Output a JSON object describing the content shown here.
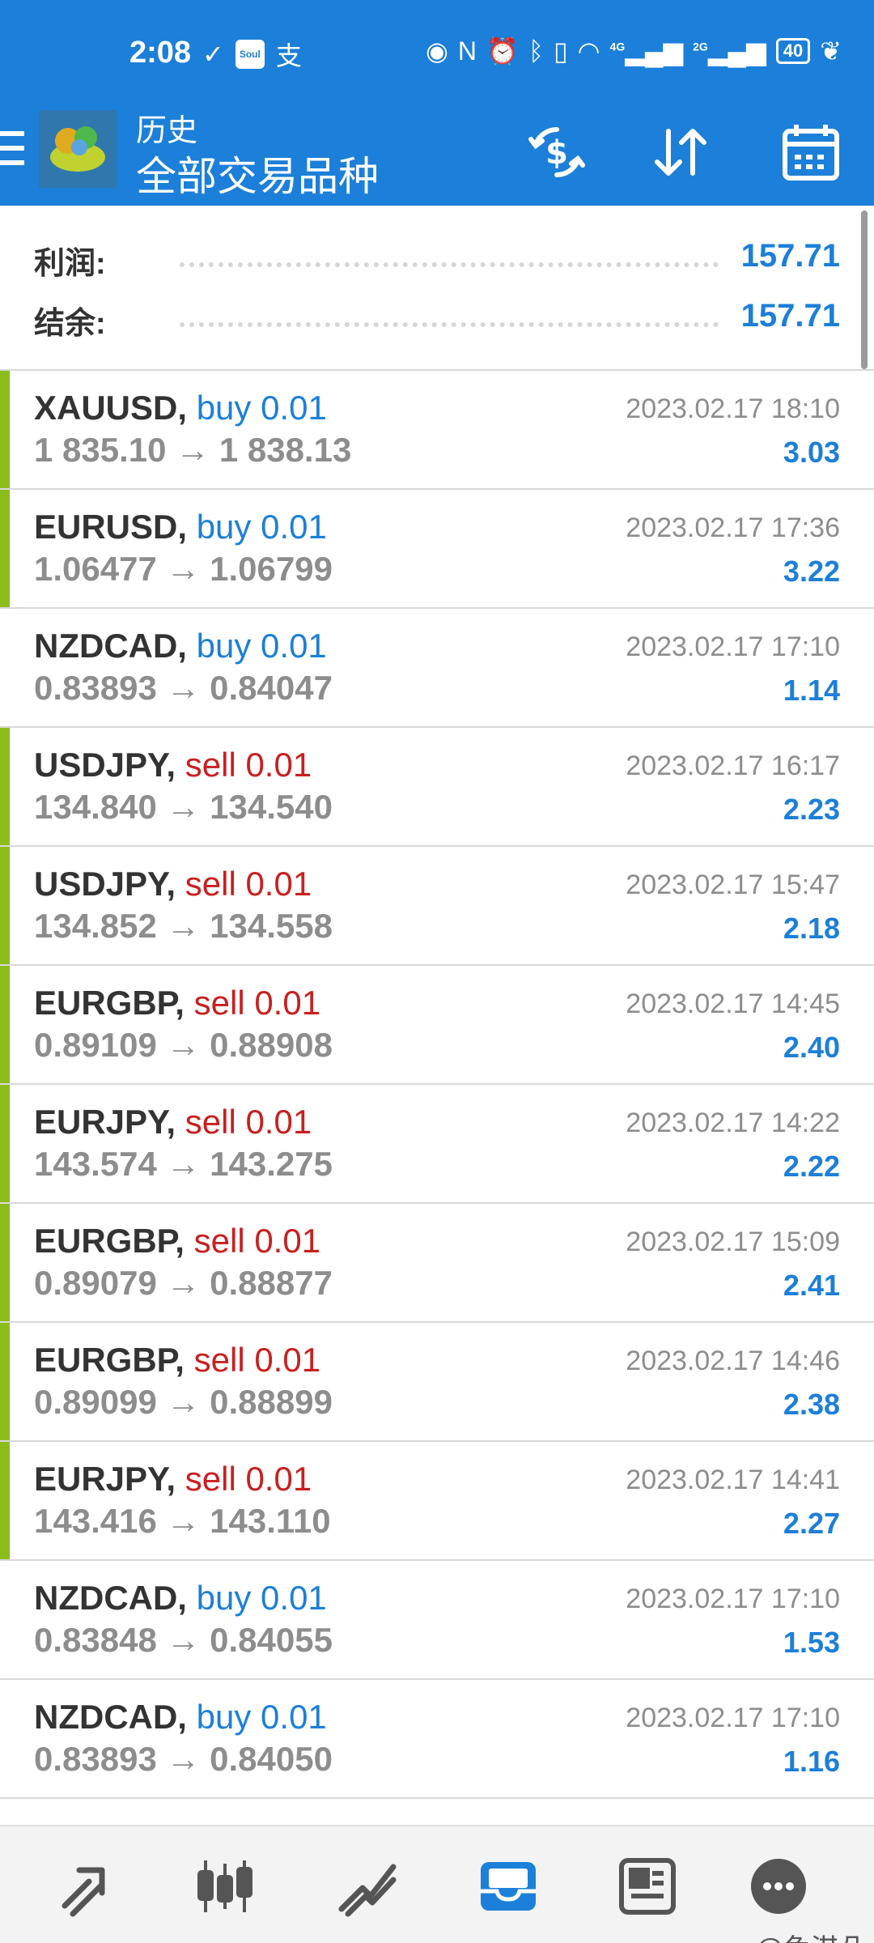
{
  "status_bar": {
    "time": "2:08",
    "soul_label": "Soul",
    "signal_4g": "4G",
    "signal_2g": "2G",
    "battery": "40"
  },
  "header": {
    "title": "历史",
    "subtitle": "全部交易品种"
  },
  "summary": {
    "profit_label": "利润:",
    "profit_value": "157.71",
    "balance_label": "结余:",
    "balance_value": "157.71"
  },
  "trades": [
    {
      "symbol": "XAUUSD,",
      "side": "buy 0.01",
      "type": "buy",
      "prices": "1 835.10 → 1 838.13",
      "date": "2023.02.17 18:10",
      "profit": "3.03",
      "marker": true
    },
    {
      "symbol": "EURUSD,",
      "side": "buy 0.01",
      "type": "buy",
      "prices": "1.06477 → 1.06799",
      "date": "2023.02.17 17:36",
      "profit": "3.22",
      "marker": true
    },
    {
      "symbol": "NZDCAD,",
      "side": "buy 0.01",
      "type": "buy",
      "prices": "0.83893 → 0.84047",
      "date": "2023.02.17 17:10",
      "profit": "1.14",
      "marker": false
    },
    {
      "symbol": "USDJPY,",
      "side": "sell 0.01",
      "type": "sell",
      "prices": "134.840 → 134.540",
      "date": "2023.02.17 16:17",
      "profit": "2.23",
      "marker": true
    },
    {
      "symbol": "USDJPY,",
      "side": "sell 0.01",
      "type": "sell",
      "prices": "134.852 → 134.558",
      "date": "2023.02.17 15:47",
      "profit": "2.18",
      "marker": true
    },
    {
      "symbol": "EURGBP,",
      "side": "sell 0.01",
      "type": "sell",
      "prices": "0.89109 → 0.88908",
      "date": "2023.02.17 14:45",
      "profit": "2.40",
      "marker": true
    },
    {
      "symbol": "EURJPY,",
      "side": "sell 0.01",
      "type": "sell",
      "prices": "143.574 → 143.275",
      "date": "2023.02.17 14:22",
      "profit": "2.22",
      "marker": true
    },
    {
      "symbol": "EURGBP,",
      "side": "sell 0.01",
      "type": "sell",
      "prices": "0.89079 → 0.88877",
      "date": "2023.02.17 15:09",
      "profit": "2.41",
      "marker": true
    },
    {
      "symbol": "EURGBP,",
      "side": "sell 0.01",
      "type": "sell",
      "prices": "0.89099 → 0.88899",
      "date": "2023.02.17 14:46",
      "profit": "2.38",
      "marker": true
    },
    {
      "symbol": "EURJPY,",
      "side": "sell 0.01",
      "type": "sell",
      "prices": "143.416 → 143.110",
      "date": "2023.02.17 14:41",
      "profit": "2.27",
      "marker": true
    },
    {
      "symbol": "NZDCAD,",
      "side": "buy 0.01",
      "type": "buy",
      "prices": "0.83848 → 0.84055",
      "date": "2023.02.17 17:10",
      "profit": "1.53",
      "marker": false
    },
    {
      "symbol": "NZDCAD,",
      "side": "buy 0.01",
      "type": "buy",
      "prices": "0.83893 → 0.84050",
      "date": "2023.02.17 17:10",
      "profit": "1.16",
      "marker": false
    }
  ],
  "colors": {
    "accent": "#1c7fd9",
    "sell": "#c8201f",
    "marker": "#8bbd1a",
    "muted": "#8d8d8d"
  },
  "icons": {
    "header": [
      "menu-icon",
      "app-logo",
      "currency-exchange-icon",
      "sort-icon",
      "calendar-icon"
    ],
    "bottom_nav": [
      "quotes-icon",
      "chart-icon",
      "trade-icon",
      "history-icon",
      "news-icon",
      "messages-icon"
    ]
  },
  "watermark": "@兔淇朵"
}
